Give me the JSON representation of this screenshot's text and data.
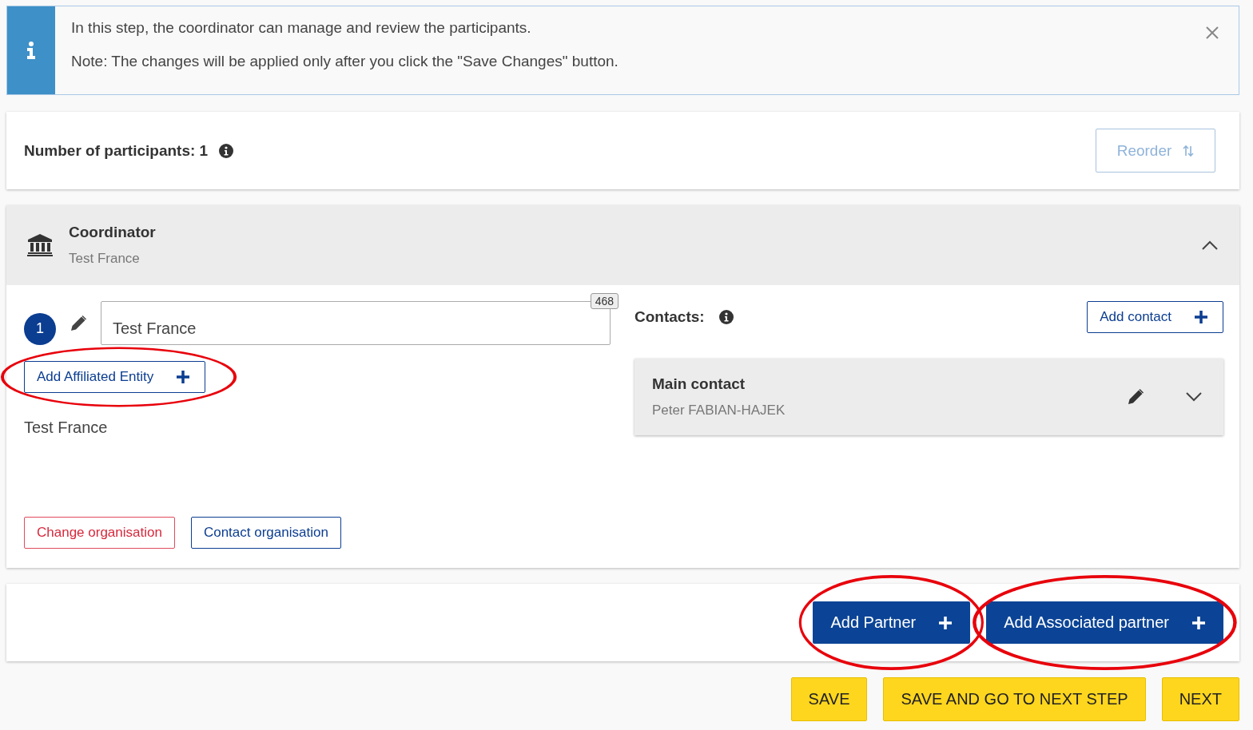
{
  "info_banner": {
    "lines": [
      "In this step, the coordinator can manage and review the participants.",
      "Note: The changes will be applied only after you click the \"Save Changes\" button."
    ]
  },
  "participants": {
    "label": "Number of participants: 1",
    "reorder_button": "Reorder"
  },
  "coordinator": {
    "title": "Coordinator",
    "subtitle": "Test France",
    "expanded": true,
    "number": "1",
    "name_field": {
      "value": "Test France",
      "counter": "468"
    },
    "affiliated_button": {
      "label": "Add Affiliated Entity",
      "highlighted": true
    },
    "organisation_name": "Test France",
    "actions": [
      {
        "label": "Change organisation",
        "kind": "danger"
      },
      {
        "label": "Contact organisation",
        "kind": "primary"
      }
    ],
    "contacts": {
      "label": "Contacts:",
      "add_button": "Add contact",
      "items": [
        {
          "title": "Main contact",
          "name": "Peter FABIAN-HAJEK",
          "expanded": false
        }
      ]
    }
  },
  "partner_buttons": [
    {
      "label": "Add Partner",
      "highlighted": true
    },
    {
      "label": "Add Associated partner",
      "highlighted": true
    }
  ],
  "footer_buttons": [
    "SAVE",
    "SAVE AND GO TO NEXT STEP",
    "NEXT"
  ]
}
